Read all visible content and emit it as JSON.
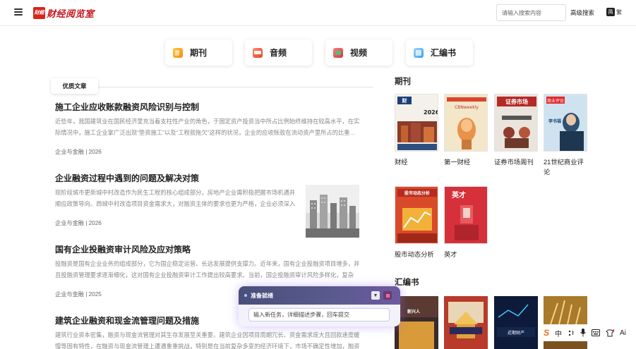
{
  "header": {
    "logo_badge": "財經",
    "logo_text": "财经阅览室",
    "search_placeholder": "请输入搜索内容",
    "advanced_search": "高级搜索",
    "lang_simplified": "简",
    "lang_traditional": "繁",
    "menu_icon": "hamburger-menu-icon"
  },
  "categories": [
    {
      "label": "期刊",
      "icon": "journal-icon"
    },
    {
      "label": "音频",
      "icon": "audio-icon"
    },
    {
      "label": "视频",
      "icon": "video-icon"
    },
    {
      "label": "汇编书",
      "icon": "compilation-icon"
    }
  ],
  "featured_tab": "优质文章",
  "articles": [
    {
      "title": "施工企业应收账款融资风险识别与控制",
      "summary": "近些年，我国建筑业在国民经济里充当着支柱性产业的角色，于固定资产投资当中所占比例始终维持在较高水平，在实际情况中，施工企业掌广泛出现“垫资施工”以及“工程款拖欠”这样的状况，企业的应收账款在流动资产里所占的比重...",
      "meta": "企业与金融 | 2026"
    },
    {
      "title": "企业融资过程中遇到的问题及解决对策",
      "summary": "现阶段城市更新城中村改造作为民生工程的核心组成部分，房地产企业需积极把握市场机遇并顺应政策导向。西城中村改造项目资金需求大，对融资主体的要求也更为严格，企业必须深入理...",
      "meta": "企业与金融 | 2026"
    },
    {
      "title": "国有企业投融资审计风险及应对策略",
      "summary": "投融资是国有企业业务的组成部分，它为国企稳定运营、长远发展提供支撑力。近年来，国有企业投融资项目增多，并且投融资管理要求逐渐细化，这对国有企业投融资审计工作提出较高要求。当前，国企投融资审计风险多样化，复杂化，且...",
      "meta": "企业与金融 | 2025"
    },
    {
      "title": "建筑企业融资和现金流管理问题及措施",
      "summary": "建筑行业资本密集，融资与现金流管理对其生存发展至关重要。建筑企业因项目周期冗长、资金需求庞大且回款速度缓慢等固有特性，在融资与现金流管理上遭遇重重挑战，特别是在当前复杂多变的经济环境下，市场不确定性增加，融资难...",
      "meta": ""
    }
  ],
  "journals_section": {
    "title": "期刊",
    "items": [
      {
        "name": "财经",
        "cover_text": "财经 2026"
      },
      {
        "name": "第一财经",
        "cover_text": "CBNweekly"
      },
      {
        "name": "证券市场周刊",
        "cover_text": "证券市场"
      },
      {
        "name": "21世纪商业评论",
        "cover_text": "21世纪商业评论"
      },
      {
        "name": "股市动态分析",
        "cover_text": "股市动态分析"
      },
      {
        "name": "英才",
        "cover_text": "英才"
      }
    ]
  },
  "compilation_section": {
    "title": "汇编书",
    "items": [
      {
        "cover_text": "新兴人"
      },
      {
        "cover_text": ""
      },
      {
        "cover_text": "近期财产"
      },
      {
        "cover_text": ""
      }
    ]
  },
  "task_panel": {
    "status": "准备就绪",
    "input_placeholder": "输入新任务，详细描述步骤，回车提交",
    "collapse_label": "▼"
  },
  "ime_bar": {
    "logo": "S",
    "lang": "中",
    "items": [
      "punctuation-icon",
      "microphone-icon",
      "keyboard-icon",
      "skin-icon",
      "ai-icon"
    ],
    "ai_label": "Ai"
  },
  "colors": {
    "brand_red": "#c8161d",
    "task_header": "#4a4f7a"
  }
}
